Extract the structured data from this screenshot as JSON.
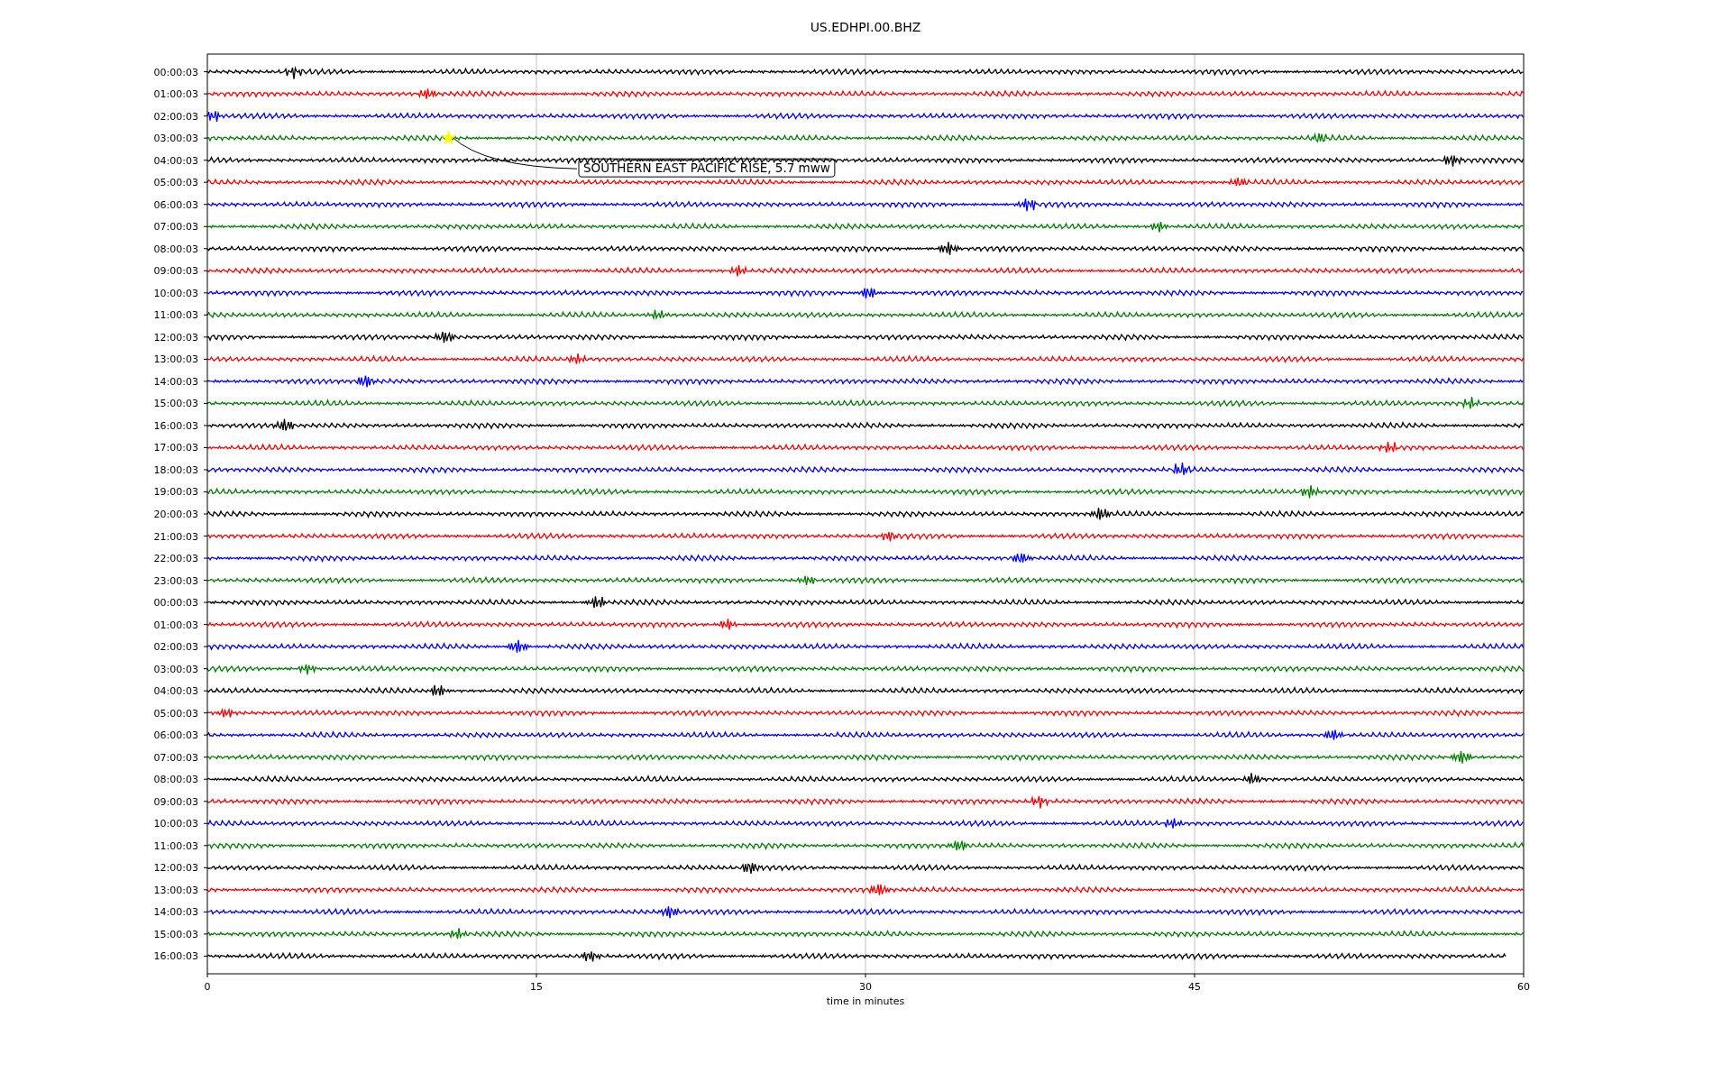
{
  "title": "US.EDHPI.00.BHZ",
  "rows": [
    {
      "label": "00:00:03",
      "color": "#000000"
    },
    {
      "label": "01:00:03",
      "color": "#ff0000"
    },
    {
      "label": "02:00:03",
      "color": "#0000ff"
    },
    {
      "label": "03:00:03",
      "color": "#008000",
      "event": {
        "label": "SOUTHERN EAST PACIFIC RISE, 5.7 mww"
      }
    },
    {
      "label": "04:00:03",
      "color": "#000000"
    },
    {
      "label": "05:00:03",
      "color": "#ff0000"
    },
    {
      "label": "06:00:03",
      "color": "#0000ff"
    },
    {
      "label": "07:00:03",
      "color": "#008000"
    },
    {
      "label": "08:00:03",
      "color": "#000000"
    },
    {
      "label": "09:00:03",
      "color": "#ff0000"
    },
    {
      "label": "10:00:03",
      "color": "#0000ff"
    },
    {
      "label": "11:00:03",
      "color": "#008000"
    },
    {
      "label": "12:00:03",
      "color": "#000000"
    },
    {
      "label": "13:00:03",
      "color": "#ff0000"
    },
    {
      "label": "14:00:03",
      "color": "#0000ff"
    },
    {
      "label": "15:00:03",
      "color": "#008000"
    },
    {
      "label": "16:00:03",
      "color": "#000000"
    },
    {
      "label": "17:00:03",
      "color": "#ff0000"
    },
    {
      "label": "18:00:03",
      "color": "#0000ff"
    },
    {
      "label": "19:00:03",
      "color": "#008000"
    },
    {
      "label": "20:00:03",
      "color": "#000000"
    },
    {
      "label": "21:00:03",
      "color": "#ff0000"
    },
    {
      "label": "22:00:03",
      "color": "#0000ff"
    },
    {
      "label": "23:00:03",
      "color": "#008000"
    },
    {
      "label": "00:00:03",
      "color": "#000000"
    },
    {
      "label": "01:00:03",
      "color": "#ff0000"
    },
    {
      "label": "02:00:03",
      "color": "#0000ff"
    },
    {
      "label": "03:00:03",
      "color": "#008000"
    },
    {
      "label": "04:00:03",
      "color": "#000000"
    },
    {
      "label": "05:00:03",
      "color": "#ff0000"
    },
    {
      "label": "06:00:03",
      "color": "#0000ff"
    },
    {
      "label": "07:00:03",
      "color": "#008000"
    },
    {
      "label": "08:00:03",
      "color": "#000000"
    },
    {
      "label": "09:00:03",
      "color": "#ff0000"
    },
    {
      "label": "10:00:03",
      "color": "#0000ff"
    },
    {
      "label": "11:00:03",
      "color": "#008000"
    },
    {
      "label": "12:00:03",
      "color": "#000000"
    },
    {
      "label": "13:00:03",
      "color": "#ff0000"
    },
    {
      "label": "14:00:03",
      "color": "#0000ff"
    },
    {
      "label": "15:00:03",
      "color": "#008000"
    },
    {
      "label": "16:00:03",
      "color": "#000000"
    }
  ],
  "x_axis": {
    "ticks": [
      "0",
      "15",
      "30",
      "45",
      "60"
    ],
    "label": "time in minutes"
  }
}
